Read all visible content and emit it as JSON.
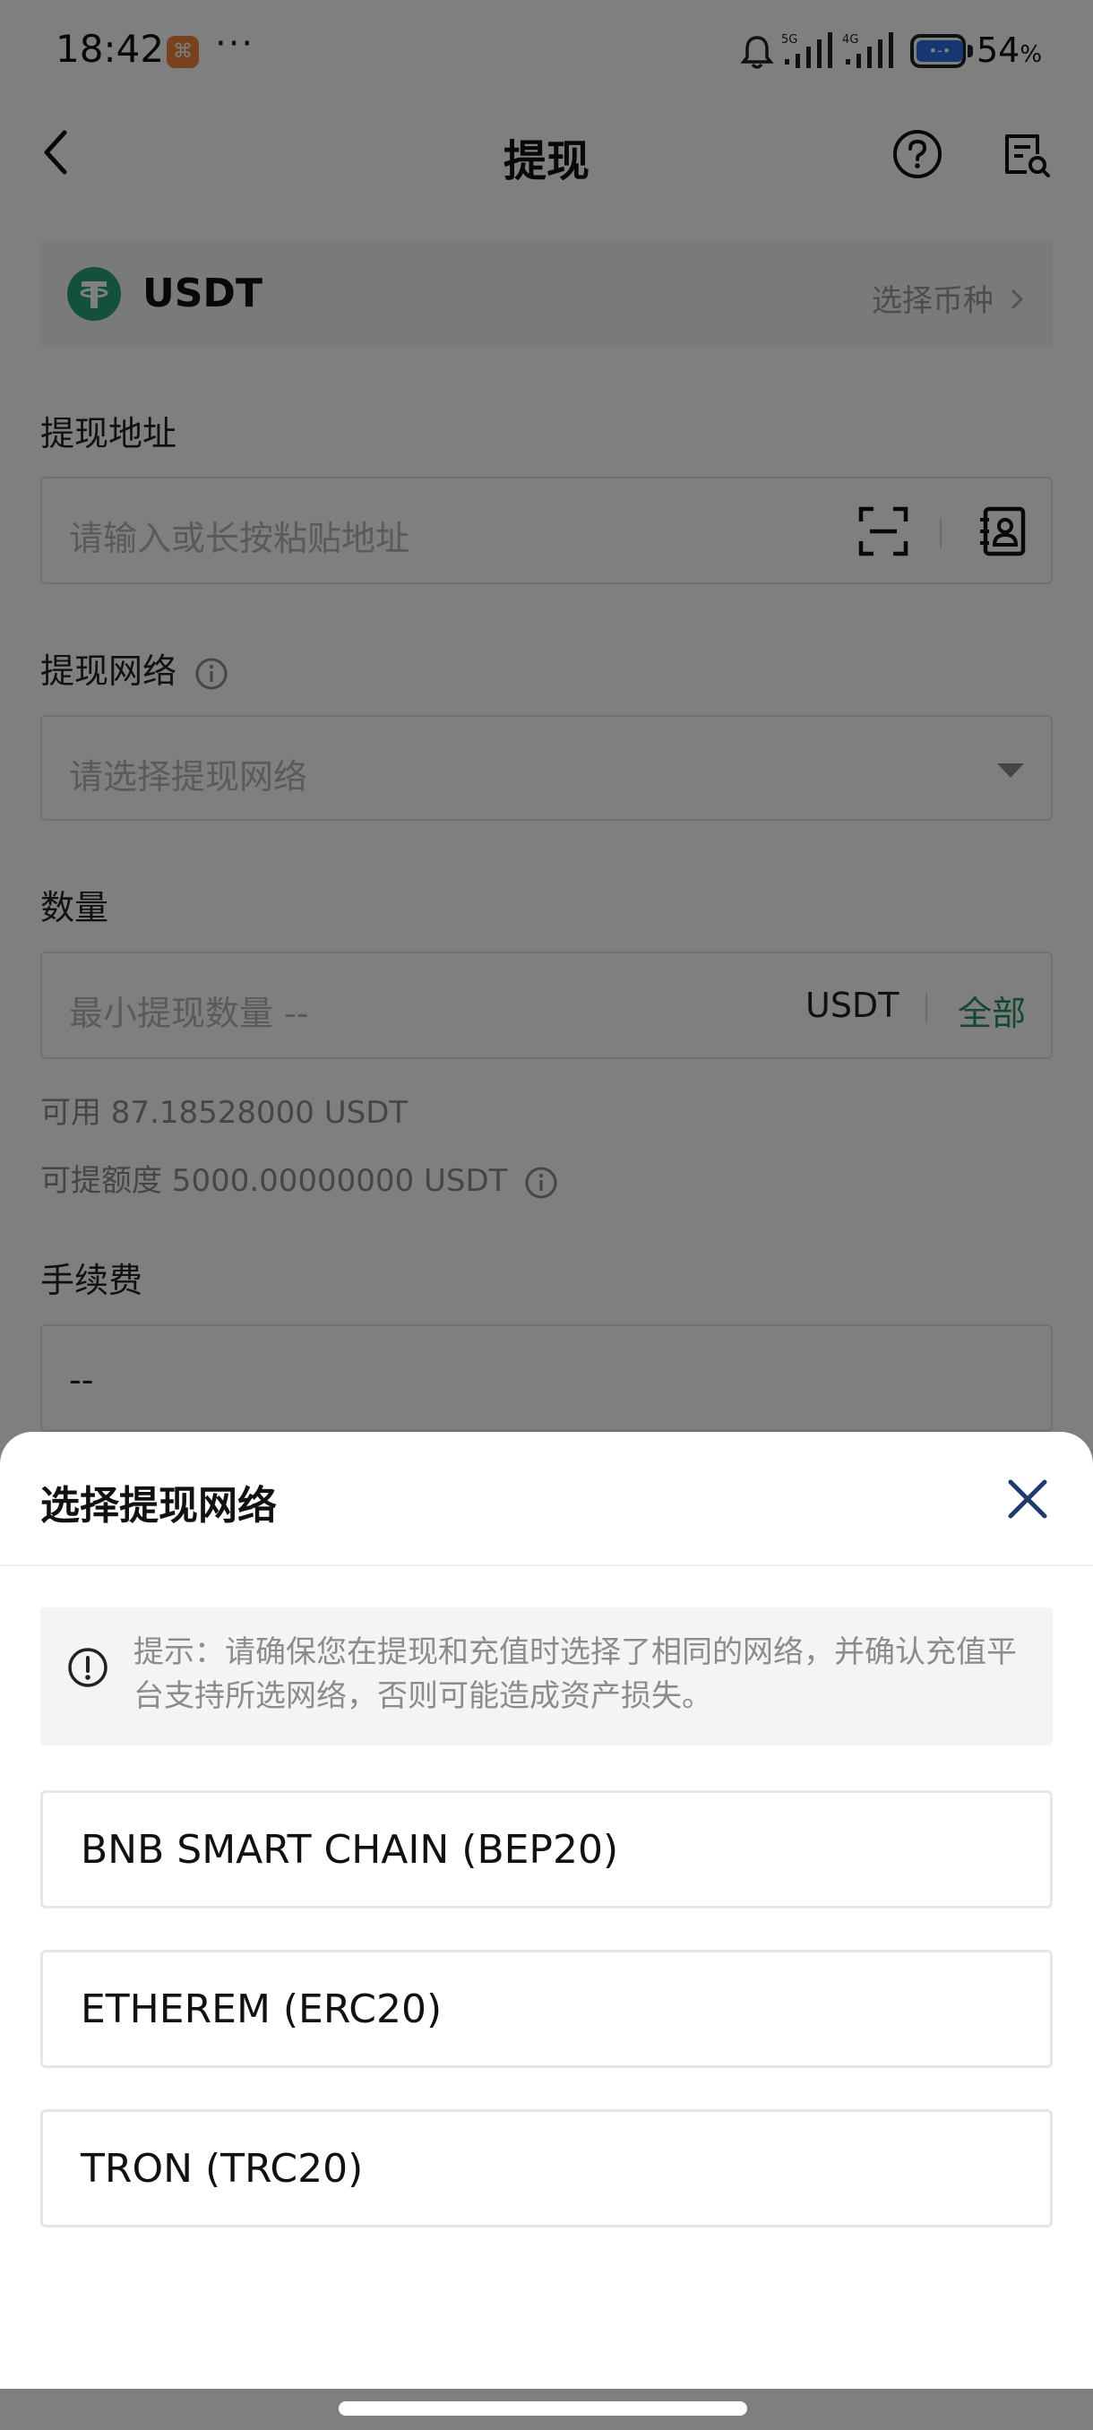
{
  "status_bar": {
    "time": "18:42",
    "app_badge": "⌘",
    "more": "···",
    "signal1_label": "5G",
    "signal2_label": "4G",
    "battery_percent": "54",
    "battery_unit": "%"
  },
  "header": {
    "title": "提现",
    "back_icon": "chevron-left-icon",
    "help_icon": "question-circle-icon",
    "records_icon": "records-search-icon"
  },
  "coin": {
    "symbol": "USDT",
    "select_label": "选择币种",
    "logo_color": "#26a17b"
  },
  "address": {
    "label": "提现地址",
    "placeholder": "请输入或长按粘贴地址"
  },
  "network": {
    "label": "提现网络",
    "placeholder": "请选择提现网络"
  },
  "amount": {
    "label": "数量",
    "placeholder": "最小提现数量 --",
    "unit": "USDT",
    "all_label": "全部",
    "available": "可用 87.18528000 USDT",
    "limit": "可提额度 5000.00000000 USDT"
  },
  "fee": {
    "label": "手续费",
    "value": "--"
  },
  "sheet": {
    "title": "选择提现网络",
    "notice": "提示：请确保您在提现和充值时选择了相同的网络，并确认充值平台支持所选网络，否则可能造成资产损失。",
    "options": [
      {
        "label": "BNB SMART CHAIN (BEP20)"
      },
      {
        "label": "ETHEREM (ERC20)"
      },
      {
        "label": "TRON (TRC20)"
      }
    ]
  },
  "colors": {
    "accent_green": "#2a8e63",
    "close_icon": "#1f3a6e",
    "overlay": "rgba(0,0,0,0.5)"
  }
}
